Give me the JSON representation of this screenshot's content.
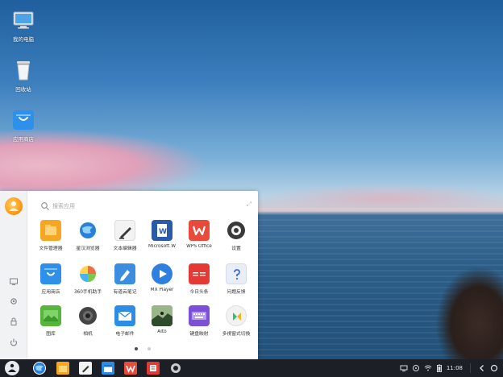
{
  "desktop": {
    "icons": [
      {
        "label": "我的电脑",
        "icon": "computer-icon"
      },
      {
        "label": "回收站",
        "icon": "recycle-bin-icon"
      },
      {
        "label": "应用商店",
        "icon": "app-store-icon"
      }
    ]
  },
  "start_menu": {
    "search_placeholder": "搜索应用",
    "expand_glyph": "⤢",
    "apps": [
      {
        "label": "文件管理器",
        "icon": "file-manager-icon",
        "color": "#f5a623"
      },
      {
        "label": "星汉浏览器",
        "icon": "browser-icon",
        "color": "#2c7fd6"
      },
      {
        "label": "文本编辑器",
        "icon": "text-editor-icon",
        "color": "#f2f2f2"
      },
      {
        "label": "Microsoft W",
        "icon": "word-icon",
        "color": "#2a5aa8"
      },
      {
        "label": "WPS Office",
        "icon": "wps-office-icon",
        "color": "#e84b3c"
      },
      {
        "label": "设置",
        "icon": "settings-icon",
        "color": "#3a3a3a"
      },
      {
        "label": "应用商店",
        "icon": "app-store-icon",
        "color": "#2f90ea"
      },
      {
        "label": "360手机助手",
        "icon": "360-assistant-icon",
        "color": "#f06b4a"
      },
      {
        "label": "有道云笔记",
        "icon": "youdao-note-icon",
        "color": "#3b8de0"
      },
      {
        "label": "MX Player",
        "icon": "mx-player-icon",
        "color": "#2f7fe0"
      },
      {
        "label": "今日头条",
        "icon": "toutiao-icon",
        "color": "#e53935"
      },
      {
        "label": "问题反馈",
        "icon": "feedback-icon",
        "color": "#e9edf5"
      },
      {
        "label": "图库",
        "icon": "gallery-icon",
        "color": "#55b53c"
      },
      {
        "label": "相机",
        "icon": "camera-icon",
        "color": "#444444"
      },
      {
        "label": "电子邮件",
        "icon": "email-icon",
        "color": "#2d8de6"
      },
      {
        "label": "Alto",
        "icon": "alto-icon",
        "color": "#3c5a3a"
      },
      {
        "label": "键盘映射",
        "icon": "keyboard-mapping-icon",
        "color": "#7b4fd6"
      },
      {
        "label": "多視窗式切換",
        "icon": "window-switch-icon",
        "color": "#f2f2f2"
      }
    ],
    "pager": {
      "count": 2,
      "active": 0
    }
  },
  "taskbar": {
    "apps": [
      {
        "icon": "start-menu-icon"
      },
      {
        "icon": "browser-icon"
      },
      {
        "icon": "file-manager-icon"
      },
      {
        "icon": "text-editor-icon"
      },
      {
        "icon": "calendar-icon"
      },
      {
        "icon": "wps-office-icon"
      },
      {
        "icon": "reader-icon"
      },
      {
        "icon": "settings-icon"
      }
    ],
    "tray": {
      "time": "11:08"
    }
  },
  "colors": {
    "taskbar_bg": "#1c2026",
    "panel_bg": "#ffffff",
    "accent_active_dot": "#4a4d52",
    "inactive_dot": "#c9cbcf"
  }
}
